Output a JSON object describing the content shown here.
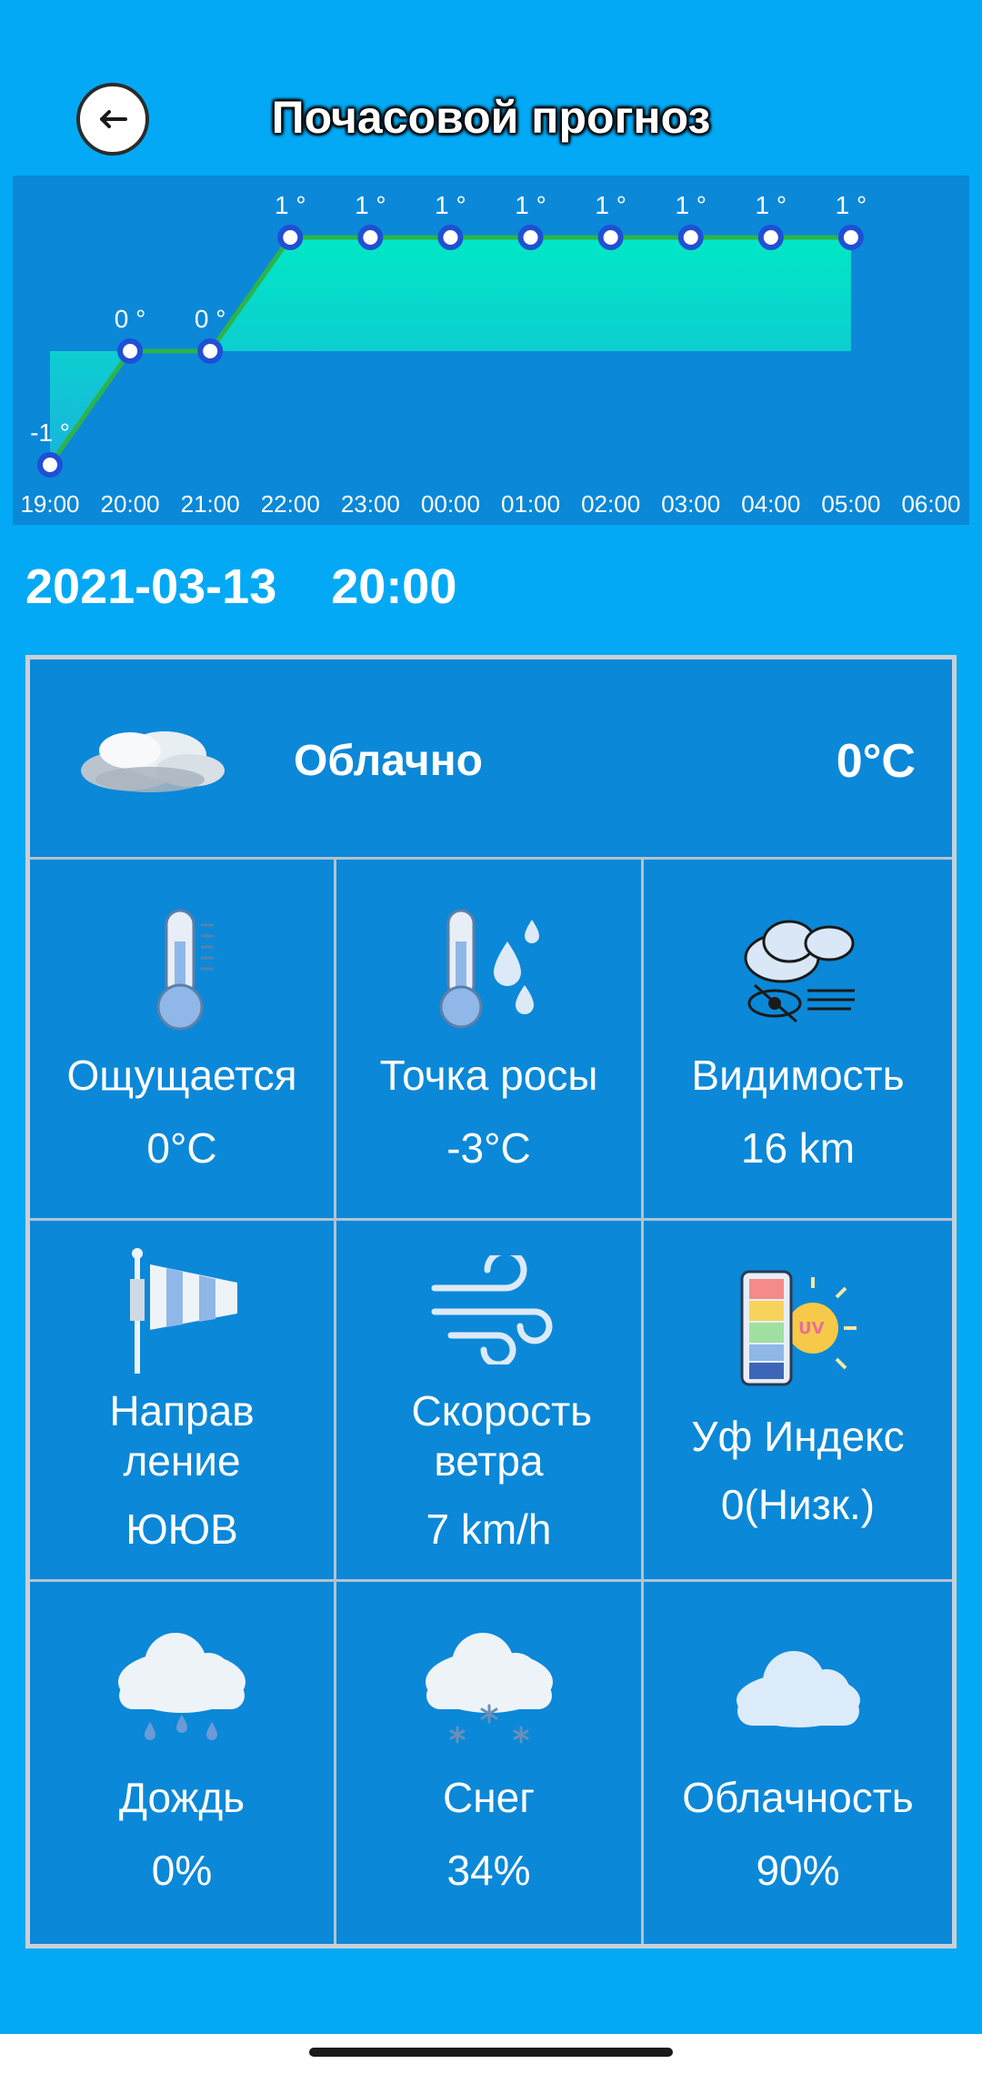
{
  "header": {
    "title": "Почасовой прогноз",
    "back_icon": "arrow-left-icon"
  },
  "chart_data": {
    "type": "line",
    "x": [
      "19:00",
      "20:00",
      "21:00",
      "22:00",
      "23:00",
      "00:00",
      "01:00",
      "02:00",
      "03:00",
      "04:00",
      "05:00",
      "06:00"
    ],
    "series": [
      {
        "values": [
          -1,
          0,
          0,
          1,
          1,
          1,
          1,
          1,
          1,
          1,
          1,
          1
        ]
      }
    ],
    "point_labels": [
      "-1 °",
      "0 °",
      "0 °",
      "1 °",
      "1 °",
      "1 °",
      "1 °",
      "1 °",
      "1 °",
      "1 °",
      "1 °",
      "1 °"
    ],
    "ylim": [
      -1,
      1
    ],
    "grid": false,
    "colors": {
      "background": "#0b88d8",
      "line": "#2db34a",
      "fill_top": "#00e8c5",
      "fill_bottom": "#1ab4dc",
      "point_fill": "#ffffff",
      "point_stroke": "#1f4fd6"
    }
  },
  "selected": {
    "date": "2021-03-13",
    "time": "20:00"
  },
  "summary": {
    "icon": "cloud-icon",
    "condition": "Облачно",
    "temperature": "0°C"
  },
  "details": [
    {
      "icon": "thermometer-icon",
      "label": "Ощущается",
      "value": "0°C"
    },
    {
      "icon": "dew-point-icon",
      "label": "Точка росы",
      "value": "-3°C"
    },
    {
      "icon": "visibility-icon",
      "label": "Видимость",
      "value": "16 km"
    },
    {
      "icon": "windsock-icon",
      "label": "Направ ление",
      "value": "ЮЮВ"
    },
    {
      "icon": "wind-icon",
      "label": "Скорость ветра",
      "value": "7 km/h"
    },
    {
      "icon": "uv-index-icon",
      "label": "Уф Индекс",
      "value": "0(Низк.)"
    },
    {
      "icon": "rain-cloud-icon",
      "label": "Дождь",
      "value": "0%"
    },
    {
      "icon": "snow-cloud-icon",
      "label": "Снег",
      "value": "34%"
    },
    {
      "icon": "cloudiness-icon",
      "label": "Облачность",
      "value": "90%"
    }
  ]
}
